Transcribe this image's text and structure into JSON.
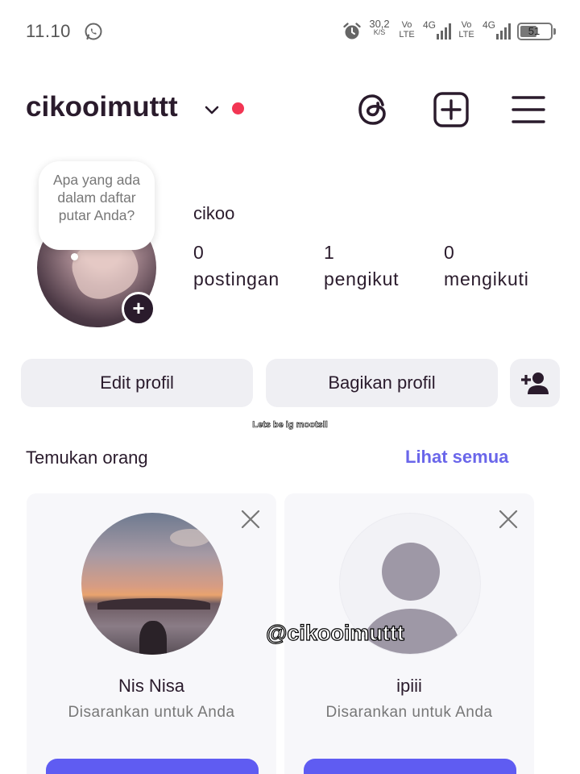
{
  "status_bar": {
    "time": "11.10",
    "net_speed": "30,2",
    "net_speed_unit": "K/S",
    "sim1_tag_top": "Vo",
    "sim1_tag_bottom": "LTE",
    "sim1_net": "4G",
    "sim2_tag_top": "Vo",
    "sim2_tag_bottom": "LTE",
    "sim2_net": "4G",
    "battery": "51",
    "icons": [
      "whatsapp-icon",
      "alarm-icon",
      "signal-icon",
      "battery-icon"
    ]
  },
  "header": {
    "username": "cikooimuttt",
    "icons": [
      "chevron-down-icon",
      "threads-icon",
      "add-post-icon",
      "menu-icon"
    ],
    "notification_dot_color": "#f23553"
  },
  "profile": {
    "note": "Apa yang ada dalam daftar putar Anda?",
    "display_name": "cikoo",
    "stats": [
      {
        "value": "0",
        "label": "postingan"
      },
      {
        "value": "1",
        "label": "pengikut"
      },
      {
        "value": "0",
        "label": "mengikuti"
      }
    ]
  },
  "actions": {
    "edit": "Edit profil",
    "share": "Bagikan profil",
    "add_icon": "add-person-icon"
  },
  "overlay": {
    "small_text": "Lets be ig mootsll",
    "handle": "@cikooimuttt"
  },
  "suggestions": {
    "title": "Temukan orang",
    "see_all": "Lihat semua",
    "accent_color": "#6a66ea",
    "cards": [
      {
        "name": "Nis Nisa",
        "subtitle": "Disarankan untuk Anda"
      },
      {
        "name": "ipiii",
        "subtitle": "Disarankan untuk Anda"
      }
    ]
  }
}
